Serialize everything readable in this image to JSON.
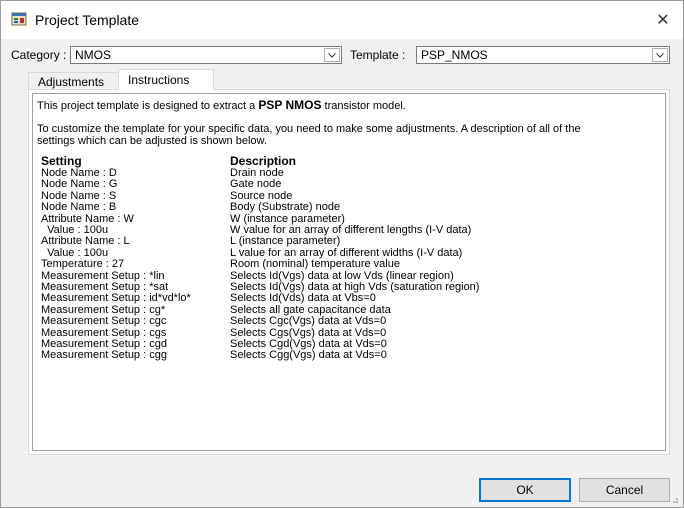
{
  "window": {
    "title": "Project Template",
    "close_symbol": "✕"
  },
  "category": {
    "label": "Category :",
    "value": "NMOS"
  },
  "template": {
    "label": "Template :",
    "value": "PSP_NMOS"
  },
  "tabs": [
    {
      "label": "Adjustments",
      "active": false
    },
    {
      "label": "Instructions",
      "active": true
    }
  ],
  "instructions": {
    "line1_prefix": "This project template is designed to extract a ",
    "line1_bold": "PSP NMOS",
    "line1_suffix": " transistor model.",
    "line2": "To customize the template for your specific data, you need to make some adjustments. A description of all of the",
    "line3": "settings which can be adjusted is shown below.",
    "header_setting": "Setting",
    "header_description": "Description",
    "rows": [
      {
        "setting": "Node Name : D",
        "description": "Drain node"
      },
      {
        "setting": "Node Name : G",
        "description": "Gate node"
      },
      {
        "setting": "Node Name : S",
        "description": "Source node"
      },
      {
        "setting": "Node Name : B",
        "description": "Body (Substrate) node"
      },
      {
        "setting": "Attribute Name : W",
        "description": "W (instance parameter)"
      },
      {
        "setting": "  Value : 100u",
        "description": "W value for an array of different lengths (I-V data)"
      },
      {
        "setting": "Attribute Name : L",
        "description": "L (instance parameter)"
      },
      {
        "setting": "  Value : 100u",
        "description": "L value for an array of different widths (I-V data)"
      },
      {
        "setting": "Temperature : 27",
        "description": "Room (nominal) temperature value"
      },
      {
        "setting": "Measurement Setup : *lin",
        "description": "Selects Id(Vgs) data at low Vds (linear region)"
      },
      {
        "setting": "Measurement Setup : *sat",
        "description": "Selects Id(Vgs) data at high Vds (saturation region)"
      },
      {
        "setting": "Measurement Setup : id*vd*lo*",
        "description": "Selects Id(Vds) data at Vbs=0"
      },
      {
        "setting": "Measurement Setup : cg*",
        "description": "Selects all gate capacitance data"
      },
      {
        "setting": "Measurement Setup : cgc",
        "description": "Selects Cgc(Vgs) data at Vds=0"
      },
      {
        "setting": "Measurement Setup : cgs",
        "description": "Selects Cgs(Vgs) data at Vds=0"
      },
      {
        "setting": "Measurement Setup : cgd",
        "description": "Selects Cgd(Vgs) data at Vds=0"
      },
      {
        "setting": "Measurement Setup : cgg",
        "description": "Selects Cgg(Vgs) data at Vds=0"
      }
    ]
  },
  "buttons": {
    "ok": "OK",
    "cancel": "Cancel"
  },
  "colors": {
    "accent": "#0078d7",
    "title_bg": "#ffffff",
    "dialog_bg": "#f0f0f0"
  }
}
